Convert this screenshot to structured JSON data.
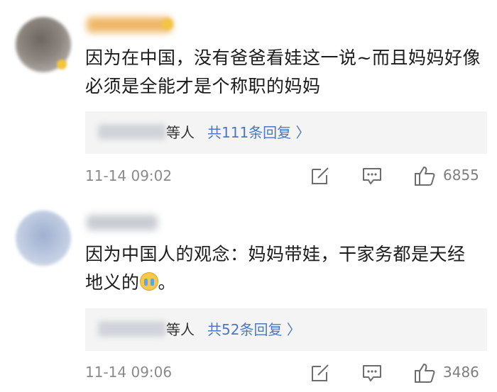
{
  "comments": [
    {
      "text": "因为在中国，没有爸爸看娃这一说~而且妈妈好像必须是全能才是个称职的妈妈",
      "replies": {
        "who": "等人",
        "count": "共111条回复 〉"
      },
      "time": "11-14 09:02",
      "likes": "6855"
    },
    {
      "text_main": "因为中国人的观念：妈妈带娃，干家务都是天经地义的",
      "text_tail": "。",
      "emoji": "crying-face-emoji",
      "replies": {
        "who": "等人",
        "count": "共52条回复 〉"
      },
      "time": "11-14 09:06",
      "likes": "3486"
    }
  ],
  "colors": {
    "link": "#4a78c4",
    "meta": "#8a8a8a",
    "reply_bg": "#f4f4f4"
  },
  "icons": [
    "share-edit-icon",
    "comment-icon",
    "thumbs-up-icon"
  ]
}
